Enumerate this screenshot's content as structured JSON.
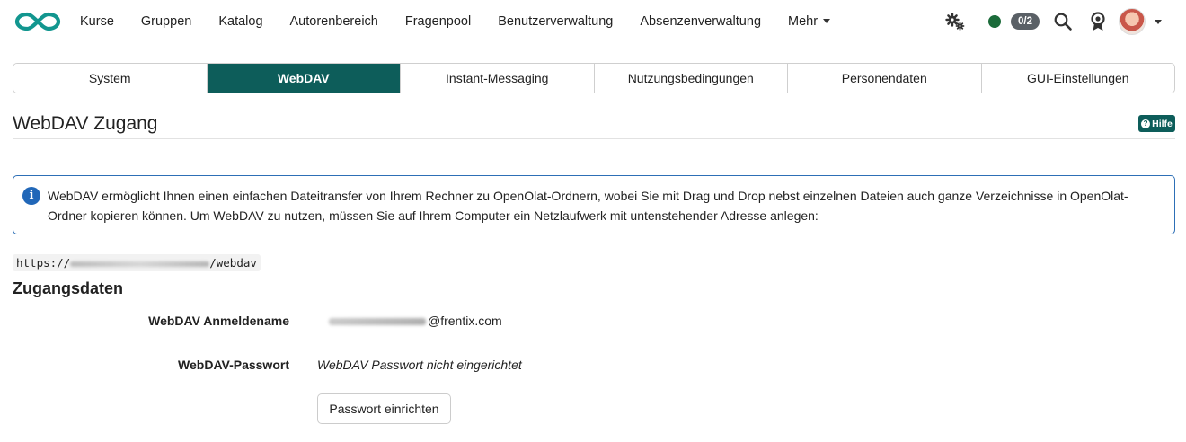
{
  "nav": {
    "links": [
      "Kurse",
      "Gruppen",
      "Katalog",
      "Autorenbereich",
      "Fragenpool",
      "Benutzerverwaltung",
      "Absenzenverwaltung"
    ],
    "more_label": "Mehr",
    "badge_count": "0/2",
    "status_color": "#1b6b3a",
    "icons": [
      "logo-infinity-icon",
      "gears-icon",
      "search-icon",
      "award-icon",
      "avatar",
      "chevron-down-icon"
    ]
  },
  "tabs": [
    {
      "label": "System",
      "active": false
    },
    {
      "label": "WebDAV",
      "active": true
    },
    {
      "label": "Instant-Messaging",
      "active": false
    },
    {
      "label": "Nutzungsbedingungen",
      "active": false
    },
    {
      "label": "Personendaten",
      "active": false
    },
    {
      "label": "GUI-Einstellungen",
      "active": false
    }
  ],
  "page": {
    "title": "WebDAV Zugang",
    "help_label": "Hilfe",
    "info_text": "WebDAV ermöglicht Ihnen einen einfachen Dateitransfer von Ihrem Rechner zu OpenOlat-Ordnern, wobei Sie mit Drag und Drop nebst einzelnen Dateien auch ganze Verzeichnisse in OpenOlat-Ordner kopieren können. Um WebDAV zu nutzen, müssen Sie auf Ihrem Computer ein Netzlaufwerk mit untenstehender Adresse anlegen:",
    "url_prefix": "https://",
    "url_suffix": "/webdav",
    "section_title": "Zugangsdaten",
    "login_label": "WebDAV Anmeldename",
    "login_suffix": "@frentix.com",
    "password_label": "WebDAV-Passwort",
    "password_value": "WebDAV Passwort nicht eingerichtet",
    "setup_button": "Passwort einrichten"
  },
  "colors": {
    "accent": "#0d5d5a",
    "info_border": "#2d6fb6",
    "info_icon": "#2167b8",
    "badge_bg": "#5a6066"
  }
}
